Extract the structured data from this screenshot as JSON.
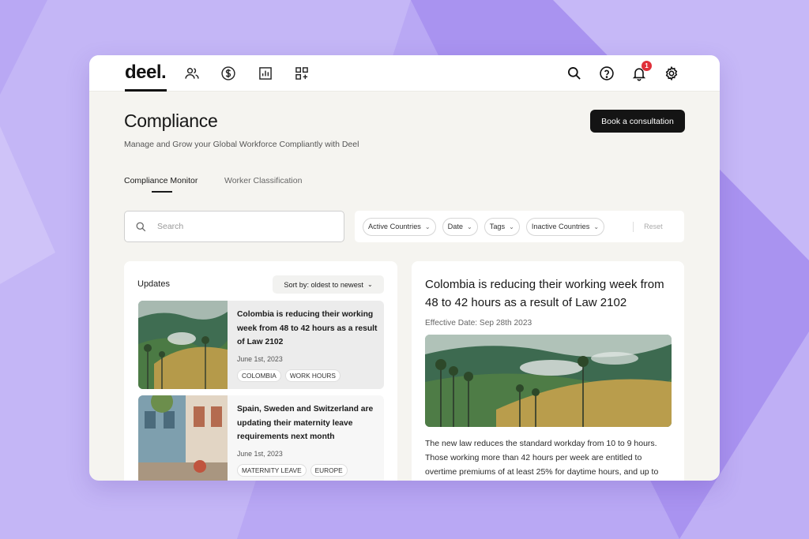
{
  "header": {
    "logo": "deel.",
    "nav_icons": [
      "people-icon",
      "dollar-icon",
      "chart-icon",
      "apps-add-icon"
    ],
    "right_icons": [
      "search-icon",
      "help-icon",
      "bell-icon",
      "gear-icon"
    ],
    "notification_count": "1"
  },
  "page": {
    "title": "Compliance",
    "subtitle": "Manage and Grow your Global Workforce Compliantly with Deel",
    "cta_label": "Book a consultation"
  },
  "tabs": [
    {
      "label": "Compliance Monitor",
      "active": true
    },
    {
      "label": "Worker Classification",
      "active": false
    }
  ],
  "search": {
    "placeholder": "Search",
    "value": ""
  },
  "filters": {
    "chips": [
      "Active Countries",
      "Date",
      "Tags",
      "Inactive Countries"
    ],
    "reset_label": "Reset"
  },
  "updates": {
    "title": "Updates",
    "sort_label": "Sort by: oldest to newest",
    "items": [
      {
        "title": "Colombia is reducing their working week from 48 to 42 hours as a result of Law 2102",
        "date": "June 1st, 2023",
        "tags": [
          "COLOMBIA",
          "WORK HOURS"
        ]
      },
      {
        "title": "Spain, Sweden and Switzerland are updating their maternity leave requirements next month",
        "date": "June 1st, 2023",
        "tags": [
          "MATERNITY LEAVE",
          "EUROPE"
        ]
      }
    ]
  },
  "detail": {
    "title": "Colombia is reducing their working week from 48 to 42 hours as a result of Law 2102",
    "effective_date": "Effective Date: Sep 28th 2023",
    "body": "The new law reduces the standard workday from 10 to 9 hours. Those working more than 42 hours per week are entitled to overtime premiums of at least 25% for daytime hours, and up to"
  },
  "colors": {
    "background": "#b8a6f3",
    "accent_dark": "#141414",
    "badge": "#e0303a"
  }
}
